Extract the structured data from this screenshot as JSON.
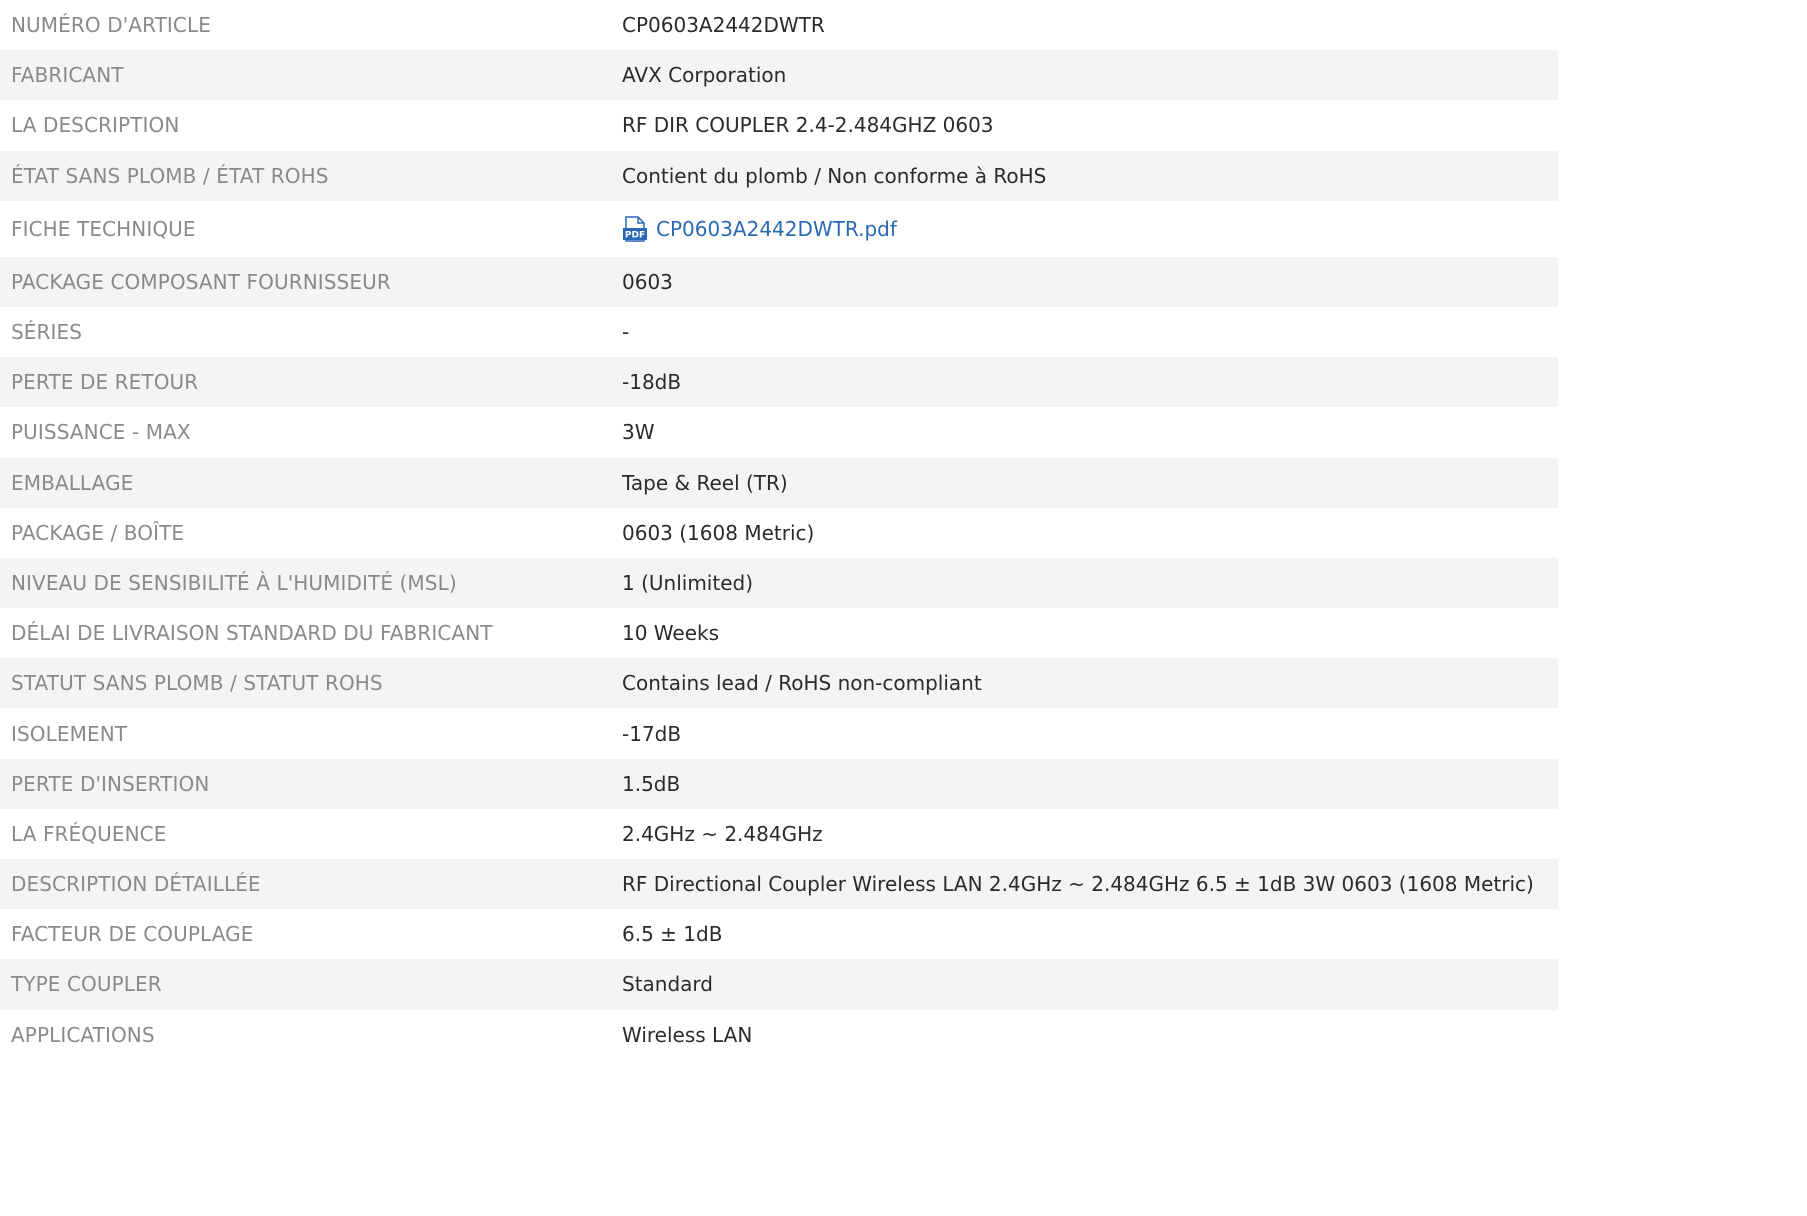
{
  "specs": {
    "rows": [
      {
        "label": "NUMÉRO D'ARTICLE",
        "value": "CP0603A2442DWTR"
      },
      {
        "label": "FABRICANT",
        "value": "AVX Corporation"
      },
      {
        "label": "LA DESCRIPTION",
        "value": "RF DIR COUPLER 2.4-2.484GHZ 0603"
      },
      {
        "label": "ÉTAT SANS PLOMB / ÉTAT ROHS",
        "value": "Contient du plomb / Non conforme à RoHS"
      },
      {
        "label": "FICHE TECHNIQUE",
        "value": "CP0603A2442DWTR.pdf",
        "icon": "pdf-file-icon"
      },
      {
        "label": "PACKAGE COMPOSANT FOURNISSEUR",
        "value": "0603"
      },
      {
        "label": "SÉRIES",
        "value": "-"
      },
      {
        "label": "PERTE DE RETOUR",
        "value": "-18dB"
      },
      {
        "label": "PUISSANCE - MAX",
        "value": "3W"
      },
      {
        "label": "EMBALLAGE",
        "value": "Tape & Reel (TR)"
      },
      {
        "label": "PACKAGE / BOÎTE",
        "value": "0603 (1608 Metric)"
      },
      {
        "label": "NIVEAU DE SENSIBILITÉ À L'HUMIDITÉ (MSL)",
        "value": "1 (Unlimited)"
      },
      {
        "label": "DÉLAI DE LIVRAISON STANDARD DU FABRICANT",
        "value": "10 Weeks"
      },
      {
        "label": "STATUT SANS PLOMB / STATUT ROHS",
        "value": "Contains lead / RoHS non-compliant"
      },
      {
        "label": "ISOLEMENT",
        "value": "-17dB"
      },
      {
        "label": "PERTE D'INSERTION",
        "value": "1.5dB"
      },
      {
        "label": "LA FRÉQUENCE",
        "value": "2.4GHz ~ 2.484GHz"
      },
      {
        "label": "DESCRIPTION DÉTAILLÉE",
        "value": "RF Directional Coupler Wireless LAN 2.4GHz ~ 2.484GHz 6.5 ± 1dB 3W 0603 (1608 Metric)"
      },
      {
        "label": "FACTEUR DE COUPLAGE",
        "value": "6.5 ± 1dB"
      },
      {
        "label": "TYPE COUPLER",
        "value": "Standard"
      },
      {
        "label": "APPLICATIONS",
        "value": "Wireless LAN"
      }
    ]
  },
  "colors": {
    "label_text": "#8a8a8a",
    "value_text": "#2b2b2b",
    "link": "#2a69b3",
    "alt_row_bg": "#f4f4f4"
  }
}
